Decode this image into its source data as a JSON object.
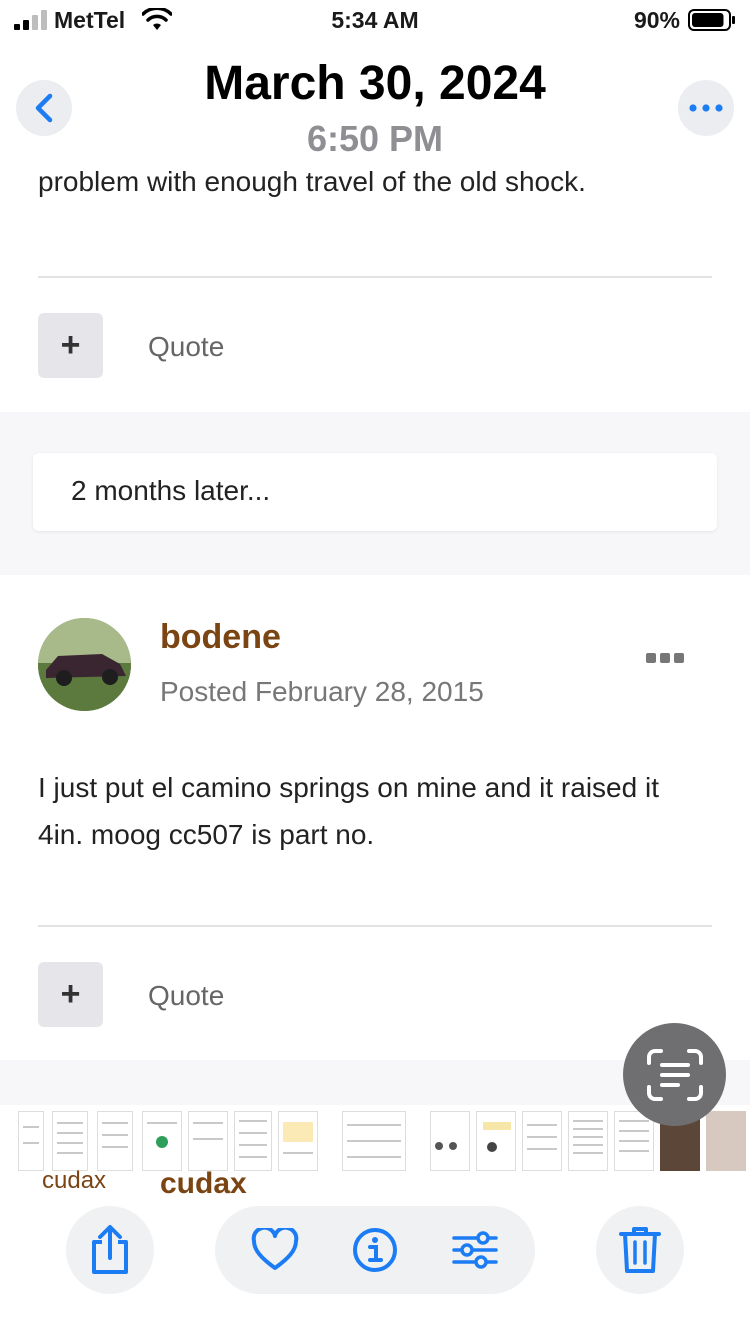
{
  "status_bar": {
    "carrier": "MetTel",
    "time": "5:34 AM",
    "battery_percent": "90%",
    "battery_level": 0.9
  },
  "photo_header": {
    "date": "March 30, 2024",
    "time": "6:50 PM"
  },
  "previous_post": {
    "last_line": "problem with enough travel of the old shock.",
    "quote_label": "Quote"
  },
  "separator": {
    "text": "2 months later..."
  },
  "post": {
    "username": "bodene",
    "posted": "Posted February 28, 2015",
    "body": "I just put el camino springs on mine and it raised it 4in. moog cc507 is part no.",
    "quote_label": "Quote"
  },
  "thumbnail_strip": {
    "labels": [
      "cudax",
      "cudax"
    ]
  },
  "toolbar": {
    "icons": [
      "share-icon",
      "heart-icon",
      "info-icon",
      "adjust-icon",
      "trash-icon"
    ]
  },
  "colors": {
    "accent_blue": "#1c7cf4",
    "username_brown": "#7a4413",
    "scan_button": "#6f6f72"
  }
}
